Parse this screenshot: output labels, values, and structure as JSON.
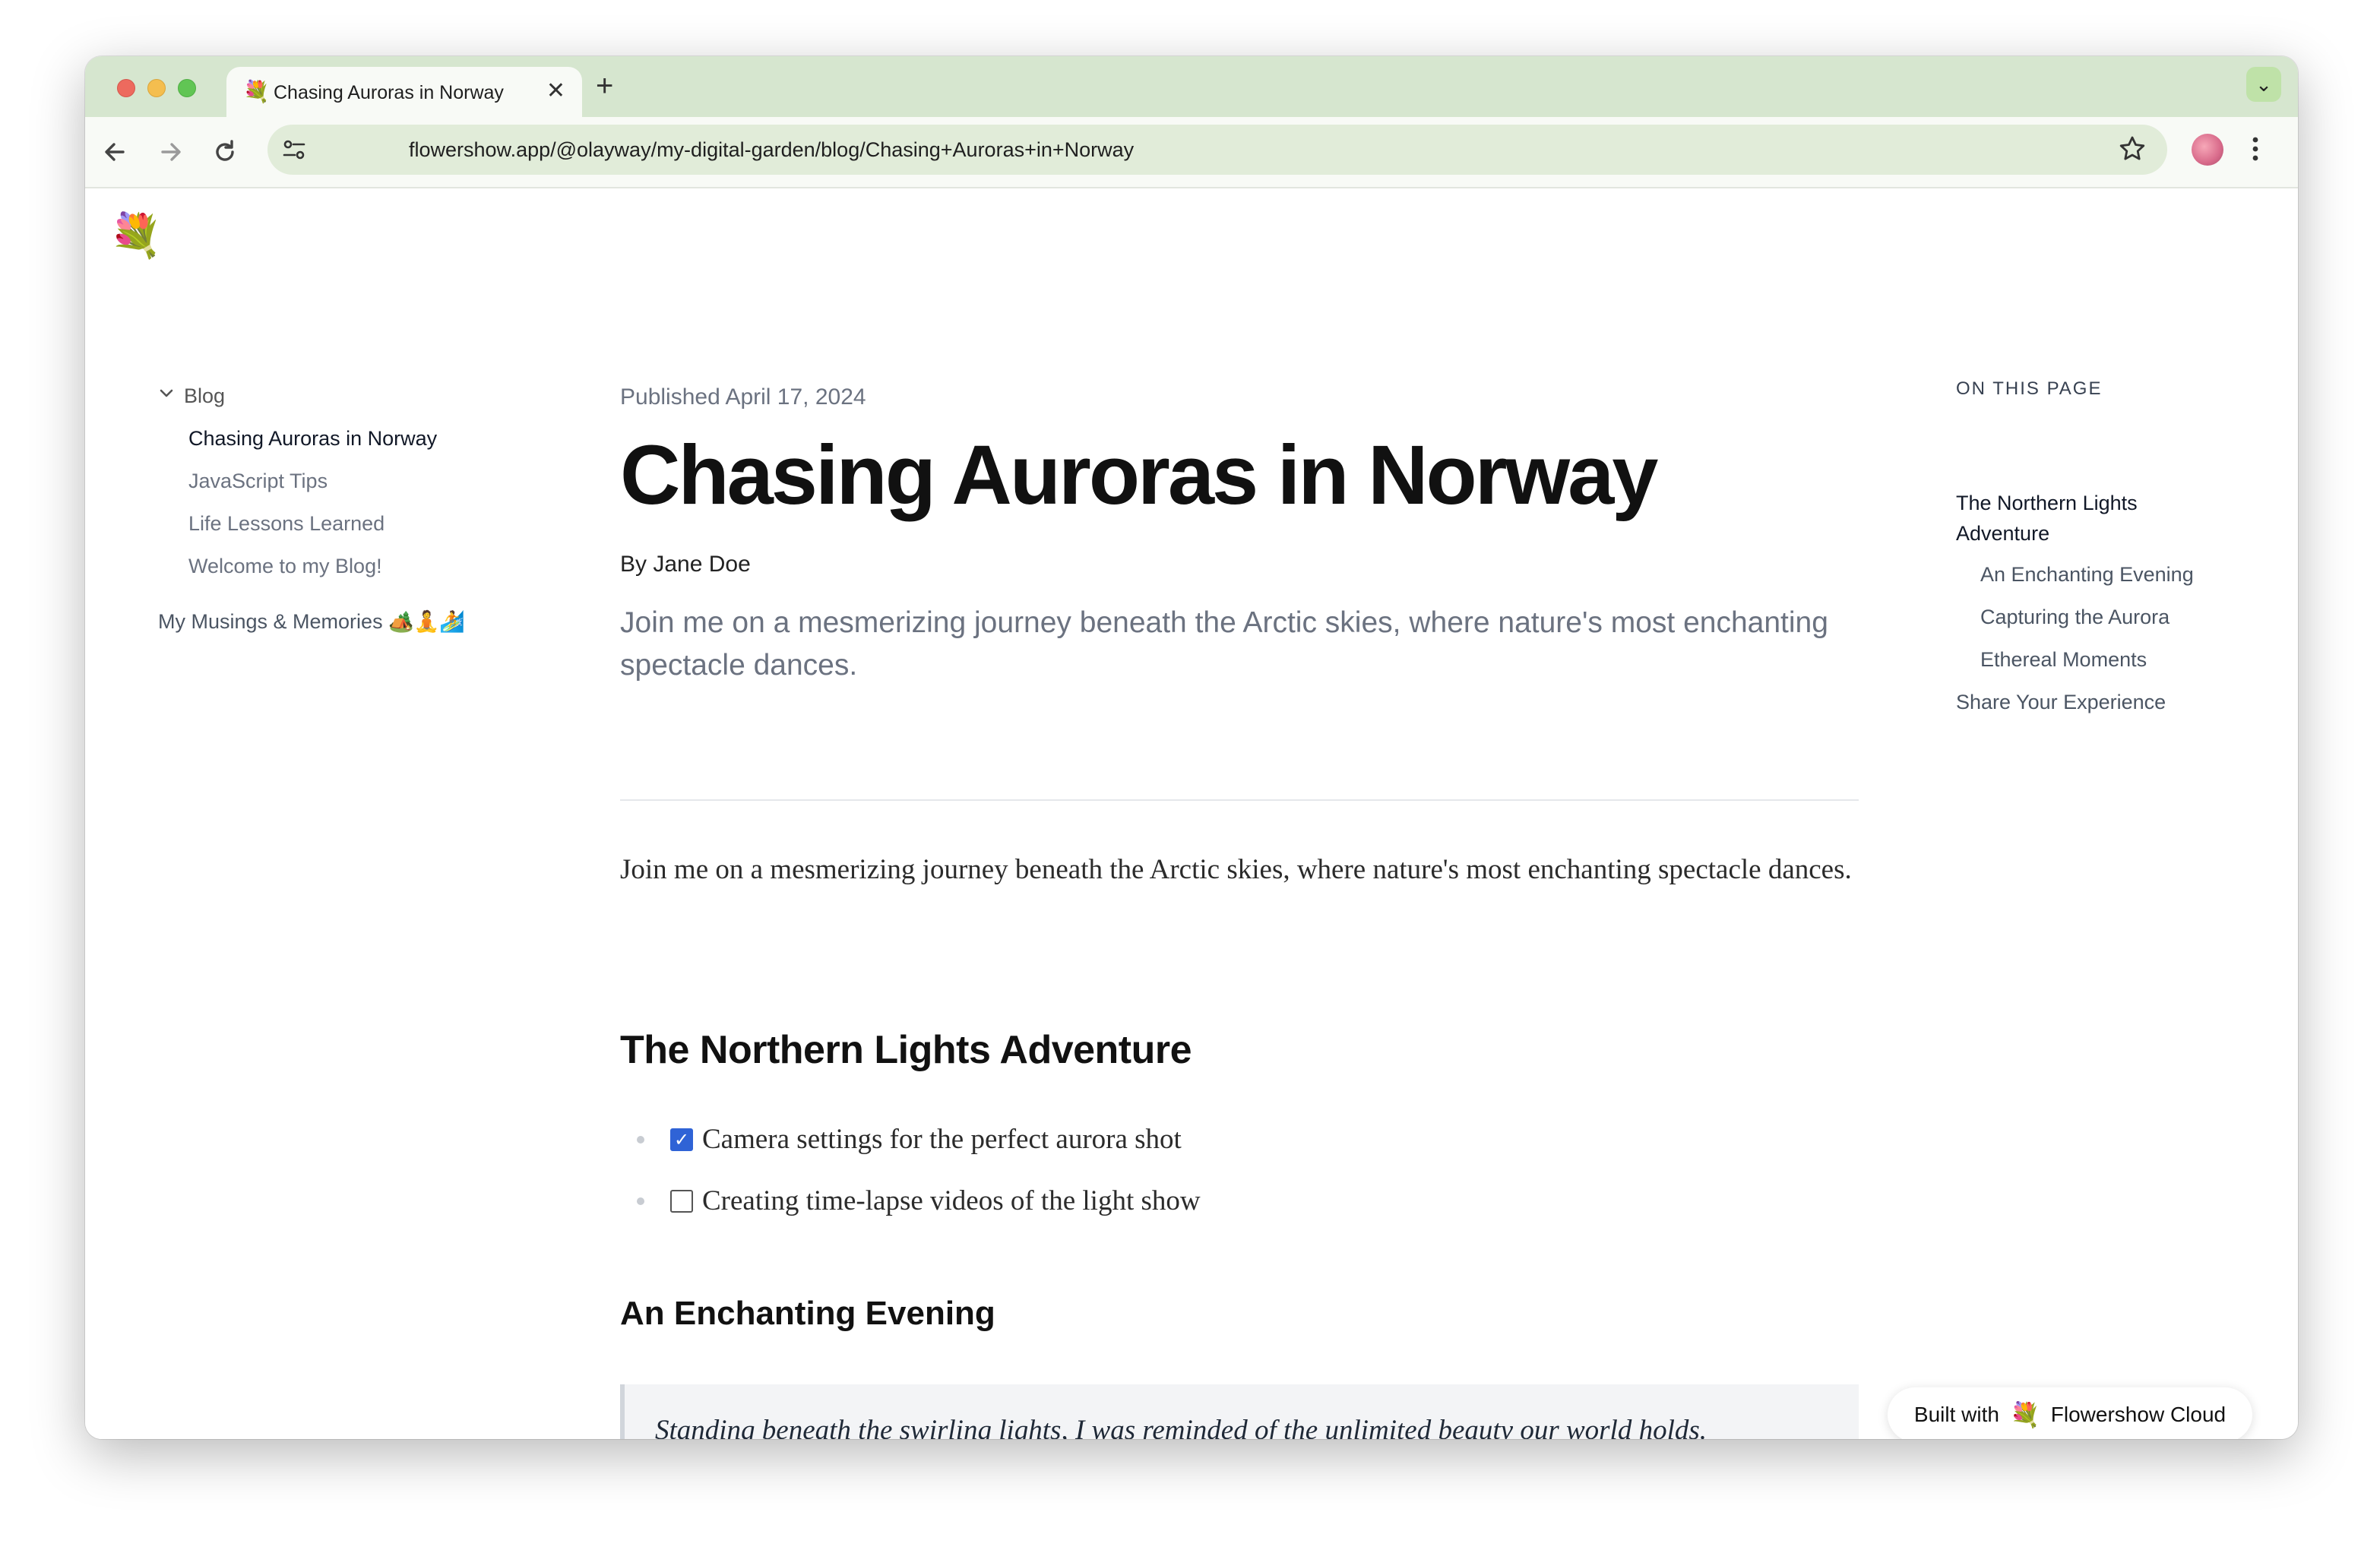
{
  "browser": {
    "tab_title": "Chasing Auroras in Norway",
    "tab_favicon": "💐",
    "tab_close": "✕",
    "new_tab": "+",
    "tab_search": "⌄",
    "url": "flowershow.app/@olayway/my-digital-garden/blog/Chasing+Auroras+in+Norway",
    "icons": {
      "back": "arrow-left-icon",
      "forward": "arrow-right-icon",
      "reload": "reload-icon",
      "site_info": "site-settings-icon",
      "bookmark": "star-icon",
      "profile": "avatar",
      "menu": "kebab-menu-icon"
    }
  },
  "site": {
    "logo": "💐"
  },
  "sidebar": {
    "group_label": "Blog",
    "items": [
      {
        "label": "Chasing Auroras in Norway",
        "active": true
      },
      {
        "label": "JavaScript Tips",
        "active": false
      },
      {
        "label": "Life Lessons Learned",
        "active": false
      },
      {
        "label": "Welcome to my Blog!",
        "active": false
      }
    ],
    "musings_label": "My Musings & Memories 🏕️🧘🏄"
  },
  "article": {
    "published": "Published April 17, 2024",
    "title": "Chasing Auroras in Norway",
    "byline": "By Jane Doe",
    "lede": "Join me on a mesmerizing journey beneath the Arctic skies, where nature's most enchanting spectacle dances.",
    "body_intro": "Join me on a mesmerizing journey beneath the Arctic skies, where nature's most enchanting spectacle dances.",
    "h2_adventure": "The Northern Lights Adventure",
    "todos": [
      {
        "label": "Camera settings for the perfect aurora shot",
        "checked": true,
        "checkmark": "✓"
      },
      {
        "label": "Creating time-lapse videos of the light show",
        "checked": false,
        "checkmark": ""
      }
    ],
    "h3_evening": "An Enchanting Evening",
    "quote": "Standing beneath the swirling lights, I was reminded of the unlimited beauty our world holds."
  },
  "toc": {
    "heading": "ON THIS PAGE",
    "items": [
      {
        "label": "The Northern Lights Adventure",
        "level": 1
      },
      {
        "label": "An Enchanting Evening",
        "level": 2
      },
      {
        "label": "Capturing the Aurora",
        "level": 2
      },
      {
        "label": "Ethereal Moments",
        "level": 2
      },
      {
        "label": "Share Your Experience",
        "level": 1
      }
    ]
  },
  "badge": {
    "prefix": "Built with",
    "flower": "💐",
    "name": "Flowershow Cloud"
  }
}
